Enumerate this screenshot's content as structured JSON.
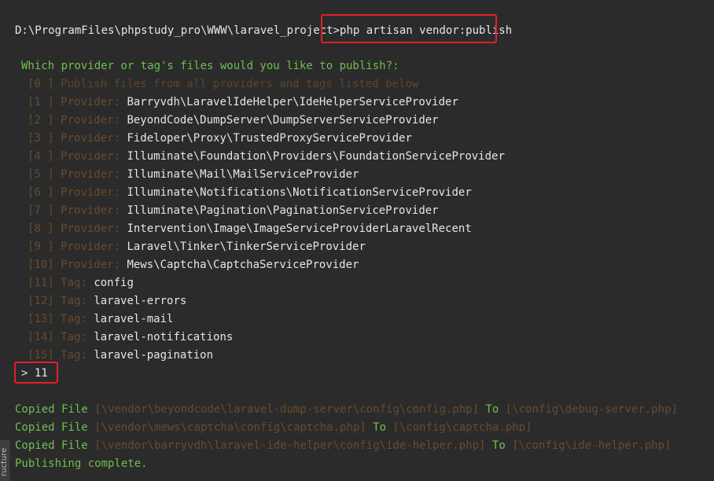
{
  "command": {
    "path": "D:\\ProgramFiles\\phpstudy_pro\\WWW\\laravel_project>",
    "cmd": "php artisan vendor:publish"
  },
  "question": "Which provider or tag's files would you like to publish?:",
  "options": [
    {
      "index": "[0 ]",
      "type": "",
      "value": "Publish files from all providers and tags listed below"
    },
    {
      "index": "[1 ]",
      "type": "Provider:",
      "value": "Barryvdh\\LaravelIdeHelper\\IdeHelperServiceProvider"
    },
    {
      "index": "[2 ]",
      "type": "Provider:",
      "value": "BeyondCode\\DumpServer\\DumpServerServiceProvider"
    },
    {
      "index": "[3 ]",
      "type": "Provider:",
      "value": "Fideloper\\Proxy\\TrustedProxyServiceProvider"
    },
    {
      "index": "[4 ]",
      "type": "Provider:",
      "value": "Illuminate\\Foundation\\Providers\\FoundationServiceProvider"
    },
    {
      "index": "[5 ]",
      "type": "Provider:",
      "value": "Illuminate\\Mail\\MailServiceProvider"
    },
    {
      "index": "[6 ]",
      "type": "Provider:",
      "value": "Illuminate\\Notifications\\NotificationServiceProvider"
    },
    {
      "index": "[7 ]",
      "type": "Provider:",
      "value": "Illuminate\\Pagination\\PaginationServiceProvider"
    },
    {
      "index": "[8 ]",
      "type": "Provider:",
      "value": "Intervention\\Image\\ImageServiceProviderLaravelRecent"
    },
    {
      "index": "[9 ]",
      "type": "Provider:",
      "value": "Laravel\\Tinker\\TinkerServiceProvider"
    },
    {
      "index": "[10]",
      "type": "Provider:",
      "value": "Mews\\Captcha\\CaptchaServiceProvider"
    },
    {
      "index": "[11]",
      "type": "Tag:",
      "value": "config"
    },
    {
      "index": "[12]",
      "type": "Tag:",
      "value": "laravel-errors"
    },
    {
      "index": "[13]",
      "type": "Tag:",
      "value": "laravel-mail"
    },
    {
      "index": "[14]",
      "type": "Tag:",
      "value": "laravel-notifications"
    },
    {
      "index": "[15]",
      "type": "Tag:",
      "value": "laravel-pagination"
    }
  ],
  "answer": "> 11",
  "copied": [
    {
      "label": "Copied File",
      "from": "[\\vendor\\beyondcode\\laravel-dump-server\\config\\config.php]",
      "to_label": "To",
      "to": "[\\config\\debug-server.php]"
    },
    {
      "label": "Copied File",
      "from": "[\\vendor\\mews\\captcha\\config\\captcha.php]",
      "to_label": "To",
      "to": "[\\config\\captcha.php]"
    },
    {
      "label": "Copied File",
      "from": "[\\vendor\\barryvdh\\laravel-ide-helper\\config\\ide-helper.php]",
      "to_label": "To",
      "to": "[\\config\\ide-helper.php]"
    }
  ],
  "complete": "Publishing complete.",
  "side_panel_label": "ructure",
  "colors": {
    "background": "#2b2b2b",
    "text": "#e6e6e6",
    "green": "#6fbf52",
    "brown": "#6a4a2e",
    "highlight_box": "#e0202a"
  }
}
